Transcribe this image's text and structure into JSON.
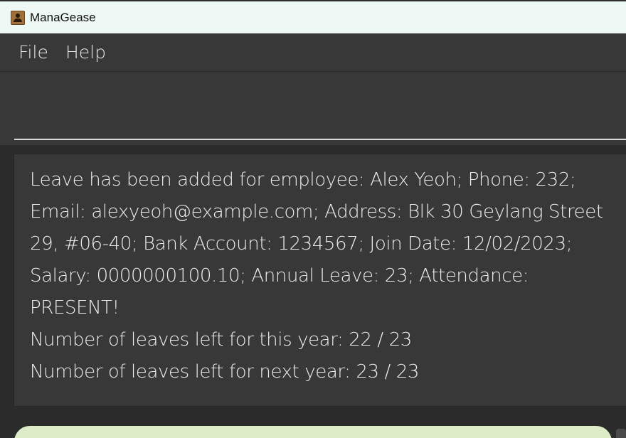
{
  "window": {
    "title": "ManaGease",
    "icon": "contact-book-icon"
  },
  "menu": {
    "items": [
      {
        "label": "File"
      },
      {
        "label": "Help"
      }
    ]
  },
  "command": {
    "value": ""
  },
  "result": {
    "text": "Leave has been added for employee: Alex Yeoh; Phone: 232;\nEmail: alexyeoh@example.com; Address: Blk 30 Geylang Street\n29, #06-40; Bank Account: 1234567; Join Date: 12/02/2023;\nSalary: 0000000100.10; Annual Leave: 23; Attendance: PRESENT!\nNumber of leaves left for this year: 22 / 23\nNumber of leaves left for next year: 23 / 23"
  },
  "colors": {
    "titlebar": "#eef8f5",
    "background": "#383838",
    "panel": "#2b2b2b",
    "text": "#ececec",
    "card": "#dcedc8"
  }
}
